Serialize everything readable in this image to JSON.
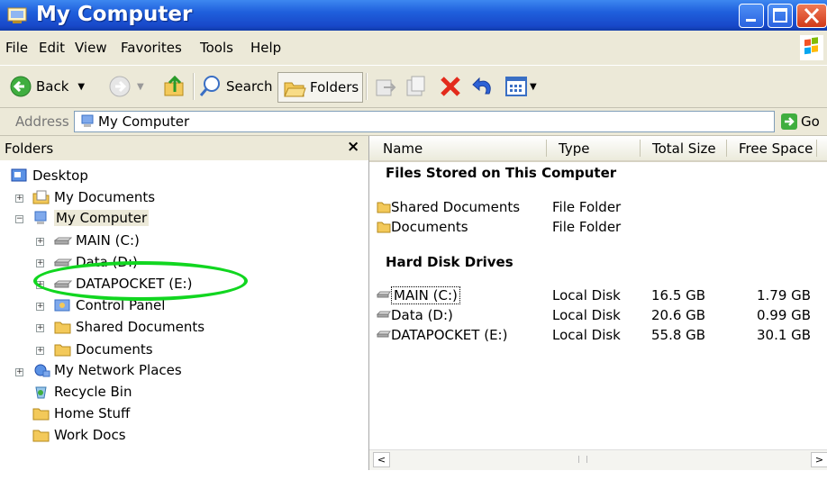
{
  "window": {
    "title": "My Computer"
  },
  "menu": [
    "File",
    "Edit",
    "View",
    "Favorites",
    "Tools",
    "Help"
  ],
  "toolbar": {
    "back": "Back",
    "search": "Search",
    "folders": "Folders"
  },
  "address": {
    "label": "Address",
    "value": "My Computer",
    "go": "Go"
  },
  "folders_pane": {
    "title": "Folders",
    "close": "×",
    "tree": [
      {
        "label": "Desktop",
        "icon": "desktop-icon"
      },
      {
        "label": "My Documents",
        "icon": "my-documents-icon"
      },
      {
        "label": "My Computer",
        "icon": "my-computer-icon"
      },
      {
        "label": "MAIN (C:)",
        "icon": "hard-drive-icon"
      },
      {
        "label": "Data (D:)",
        "icon": "hard-drive-icon"
      },
      {
        "label": "DATAPOCKET (E:)",
        "icon": "hard-drive-icon"
      },
      {
        "label": "Control Panel",
        "icon": "control-panel-icon"
      },
      {
        "label": "Shared Documents",
        "icon": "folder-icon"
      },
      {
        "label": "Documents",
        "icon": "folder-icon"
      },
      {
        "label": "My Network Places",
        "icon": "network-places-icon"
      },
      {
        "label": "Recycle Bin",
        "icon": "recycle-bin-icon"
      },
      {
        "label": "Home Stuff",
        "icon": "folder-icon"
      },
      {
        "label": "Work Docs",
        "icon": "folder-icon"
      }
    ]
  },
  "list": {
    "columns": [
      "Name",
      "Type",
      "Total Size",
      "Free Space"
    ],
    "groups": [
      {
        "title": "Files Stored on This Computer",
        "items": [
          {
            "name": "Shared Documents",
            "type": "File Folder",
            "total": "",
            "free": ""
          },
          {
            "name": "Documents",
            "type": "File Folder",
            "total": "",
            "free": ""
          }
        ]
      },
      {
        "title": "Hard Disk Drives",
        "items": [
          {
            "name": "MAIN (C:)",
            "type": "Local Disk",
            "total": "16.5 GB",
            "free": "1.79 GB"
          },
          {
            "name": "Data (D:)",
            "type": "Local Disk",
            "total": "20.6 GB",
            "free": "0.99 GB"
          },
          {
            "name": "DATAPOCKET (E:)",
            "type": "Local Disk",
            "total": "55.8 GB",
            "free": "30.1 GB"
          }
        ]
      }
    ]
  },
  "colors": {
    "highlight_circle": "#11d620",
    "titlebar": "#1f5fdc"
  }
}
